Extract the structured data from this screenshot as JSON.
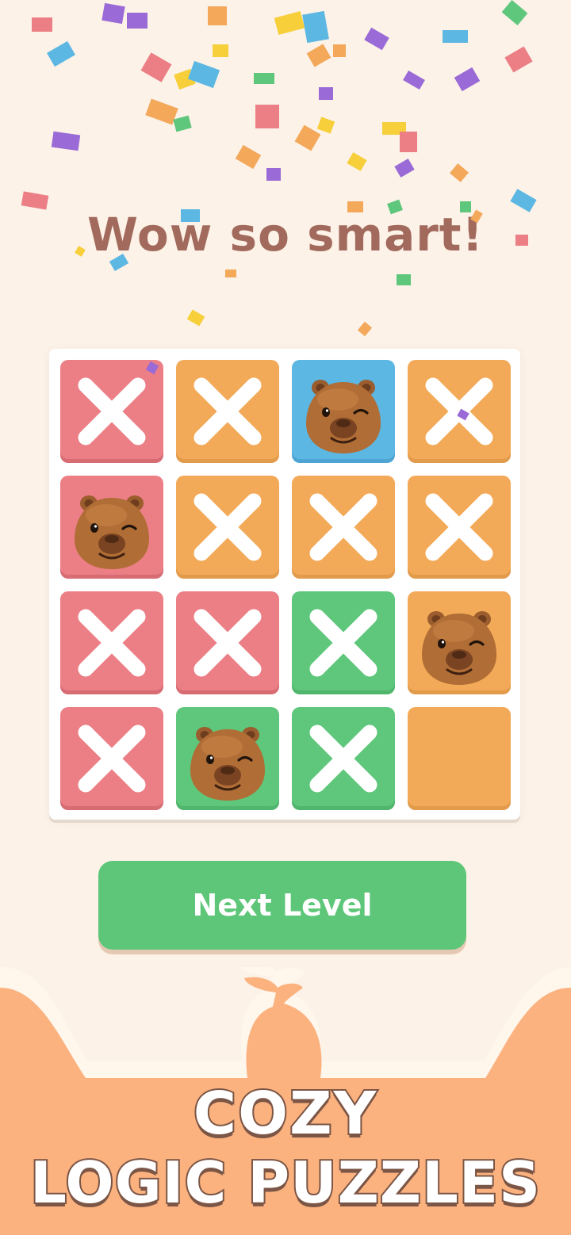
{
  "headline": "Wow so smart!",
  "board": {
    "rows": 4,
    "cols": 4,
    "tiles": [
      {
        "color": "red",
        "mark": "x"
      },
      {
        "color": "orange",
        "mark": "x"
      },
      {
        "color": "blue",
        "mark": "capybara"
      },
      {
        "color": "orange",
        "mark": "x"
      },
      {
        "color": "red",
        "mark": "capybara"
      },
      {
        "color": "orange",
        "mark": "x"
      },
      {
        "color": "orange",
        "mark": "x"
      },
      {
        "color": "orange",
        "mark": "x"
      },
      {
        "color": "red",
        "mark": "x"
      },
      {
        "color": "red",
        "mark": "x"
      },
      {
        "color": "green",
        "mark": "x"
      },
      {
        "color": "orange",
        "mark": "capybara"
      },
      {
        "color": "red",
        "mark": "x"
      },
      {
        "color": "green",
        "mark": "capybara"
      },
      {
        "color": "green",
        "mark": "x"
      },
      {
        "color": "orange",
        "mark": "empty"
      }
    ]
  },
  "next_button": {
    "label": "Next Level"
  },
  "tagline": {
    "line1": "COZY",
    "line2": "LOGIC PUZZLES"
  },
  "colors": {
    "background": "#fcf2e8",
    "headline": "#a26a5c",
    "red": "#ec7f86",
    "orange": "#f3aa58",
    "blue": "#5cb7e3",
    "green": "#5ec77b",
    "button": "#5dc678",
    "banner": "#fbb27f",
    "tagline_outline": "#7b5545"
  },
  "confetti_colors": [
    "#ec7f86",
    "#f3a85a",
    "#5cb7e3",
    "#9a6ad6",
    "#f6cf3b",
    "#5ec77b"
  ]
}
